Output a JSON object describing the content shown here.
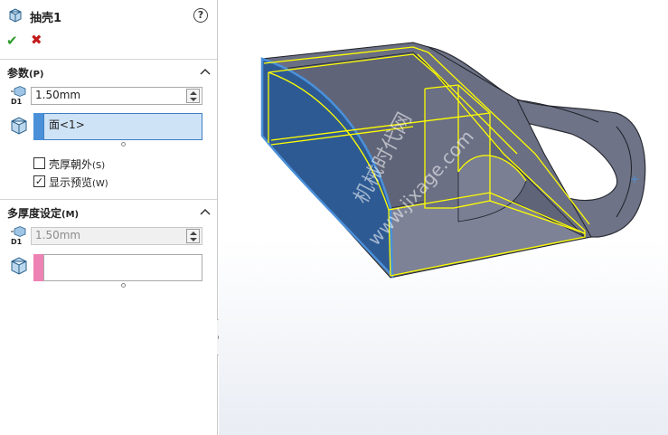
{
  "header": {
    "title": "抽壳1",
    "help_icon": "?",
    "ok_icon": "✔",
    "cancel_icon": "✖"
  },
  "parameters": {
    "title": "参数",
    "hotkey": "(P)",
    "thickness_value": "1.50mm",
    "faces_to_remove": "面<1>",
    "faces_swatch_color": "#4a90d9",
    "shell_outward": {
      "label": "壳厚朝外",
      "hotkey": "(S)",
      "checked": false
    },
    "show_preview": {
      "label": "显示预览",
      "hotkey": "(W)",
      "checked": true
    }
  },
  "multi_thickness": {
    "title": "多厚度设定",
    "hotkey": "(M)",
    "thickness_value": "1.50mm",
    "faces_swatch_color": "#ee82b4"
  },
  "watermark": {
    "line1": "机械时代网",
    "line2": "www.jixage.com"
  },
  "colors": {
    "model_body": "#6e7387",
    "selected_face": "#2e5a93",
    "preview_edges": "#ffff00"
  }
}
